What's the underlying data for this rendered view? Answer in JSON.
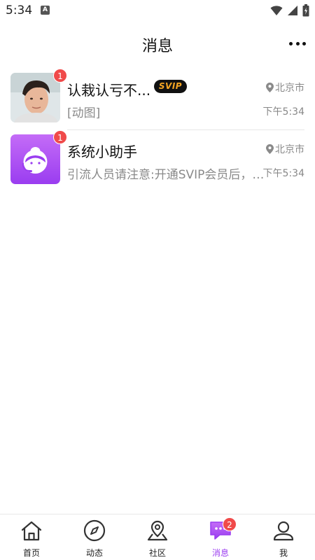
{
  "status_bar": {
    "time": "5:34",
    "notification_icon": "a-icon"
  },
  "header": {
    "title": "消息",
    "more_icon": "more-dots-icon"
  },
  "conversations": [
    {
      "name": "认栽认亏不...",
      "vip_badge": "SVIP",
      "location": "北京市",
      "preview": "[动图]",
      "time": "下午5:34",
      "unread": "1"
    },
    {
      "name": "系统小助手",
      "location": "北京市",
      "preview": "引流人员请注意:开通SVIP会员后，…",
      "time": "下午5:34",
      "unread": "1",
      "avatar_color": "#a64df5"
    }
  ],
  "tabbar": {
    "active_color": "#9b3df0",
    "tabs": [
      {
        "label": "首页",
        "icon": "home-icon"
      },
      {
        "label": "动态",
        "icon": "compass-icon"
      },
      {
        "label": "社区",
        "icon": "map-pin-icon"
      },
      {
        "label": "消息",
        "icon": "chat-icon",
        "badge": "2"
      },
      {
        "label": "我",
        "icon": "user-icon"
      }
    ]
  }
}
